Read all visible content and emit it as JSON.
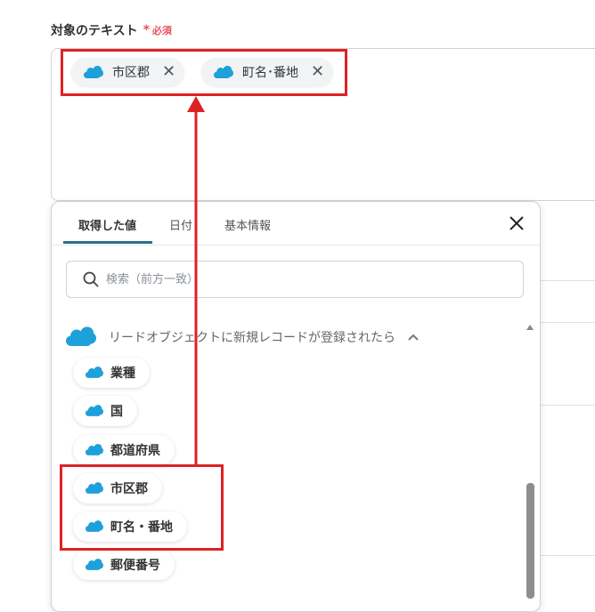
{
  "field": {
    "label": "対象のテキスト",
    "required_mark": "*",
    "required_text": "必須"
  },
  "selected_chips": [
    {
      "label": "市区郡",
      "icon": "salesforce-cloud-icon",
      "remove_icon": "close-icon"
    },
    {
      "label": "町名･番地",
      "icon": "salesforce-cloud-icon",
      "remove_icon": "close-icon"
    }
  ],
  "panel": {
    "tabs": [
      {
        "label": "取得した値",
        "active": true
      },
      {
        "label": "日付",
        "active": false
      },
      {
        "label": "基本情報",
        "active": false
      }
    ],
    "close_icon": "close-icon",
    "search": {
      "placeholder": "検索（前方一致）",
      "value": "",
      "icon": "search-icon"
    },
    "group": {
      "label": "リードオブジェクトに新規レコードが登録されたら",
      "icon": "salesforce-cloud-icon",
      "toggle_icon": "chevron-up-icon"
    },
    "items": [
      {
        "label": "業種"
      },
      {
        "label": "国"
      },
      {
        "label": "都道府県"
      },
      {
        "label": "市区郡"
      },
      {
        "label": "町名・番地"
      },
      {
        "label": "郵便番号"
      }
    ]
  },
  "colors": {
    "accent": "#2b6f8a",
    "required": "#e8525f",
    "salesforce": "#1ea0db",
    "highlight": "#dd2222"
  }
}
